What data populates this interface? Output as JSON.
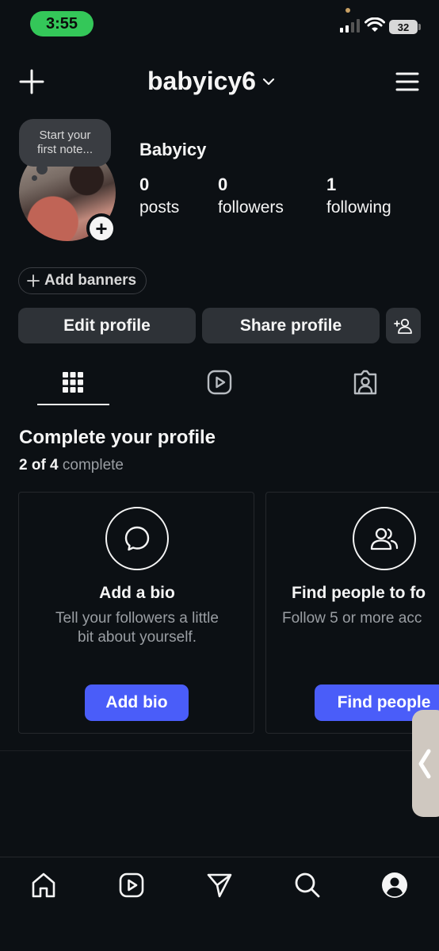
{
  "status_bar": {
    "time": "3:55",
    "battery": "32"
  },
  "header": {
    "username": "babyicy6"
  },
  "note": {
    "line1": "Start your",
    "line2": "first note..."
  },
  "profile": {
    "display_name": "Babyicy",
    "stats": [
      {
        "value": "0",
        "label": "posts"
      },
      {
        "value": "0",
        "label": "followers"
      },
      {
        "value": "1",
        "label": "following"
      }
    ]
  },
  "banners": {
    "label": "Add banners"
  },
  "actions": {
    "edit": "Edit profile",
    "share": "Share profile"
  },
  "tabs": [
    {
      "icon": "grid-icon",
      "selected": true
    },
    {
      "icon": "reels-icon",
      "selected": false
    },
    {
      "icon": "tagged-icon",
      "selected": false
    }
  ],
  "complete_profile": {
    "title": "Complete your profile",
    "progress_done": "2 of 4",
    "progress_word": "complete",
    "cards": [
      {
        "icon": "chat-bubble-icon",
        "title": "Add a bio",
        "desc_line1": "Tell your followers a little",
        "desc_line2": "bit about yourself.",
        "button": "Add bio"
      },
      {
        "icon": "people-icon",
        "title": "Find people to fo",
        "desc_line1": "Follow 5 or more acc",
        "button": "Find people"
      }
    ]
  },
  "colors": {
    "accent": "#4a5df9",
    "background": "#0c1014",
    "button_bg": "#2e3237",
    "status_green": "#34c759"
  },
  "bottom_nav": [
    "home-icon",
    "reels-icon",
    "messages-icon",
    "search-icon",
    "profile-icon"
  ]
}
